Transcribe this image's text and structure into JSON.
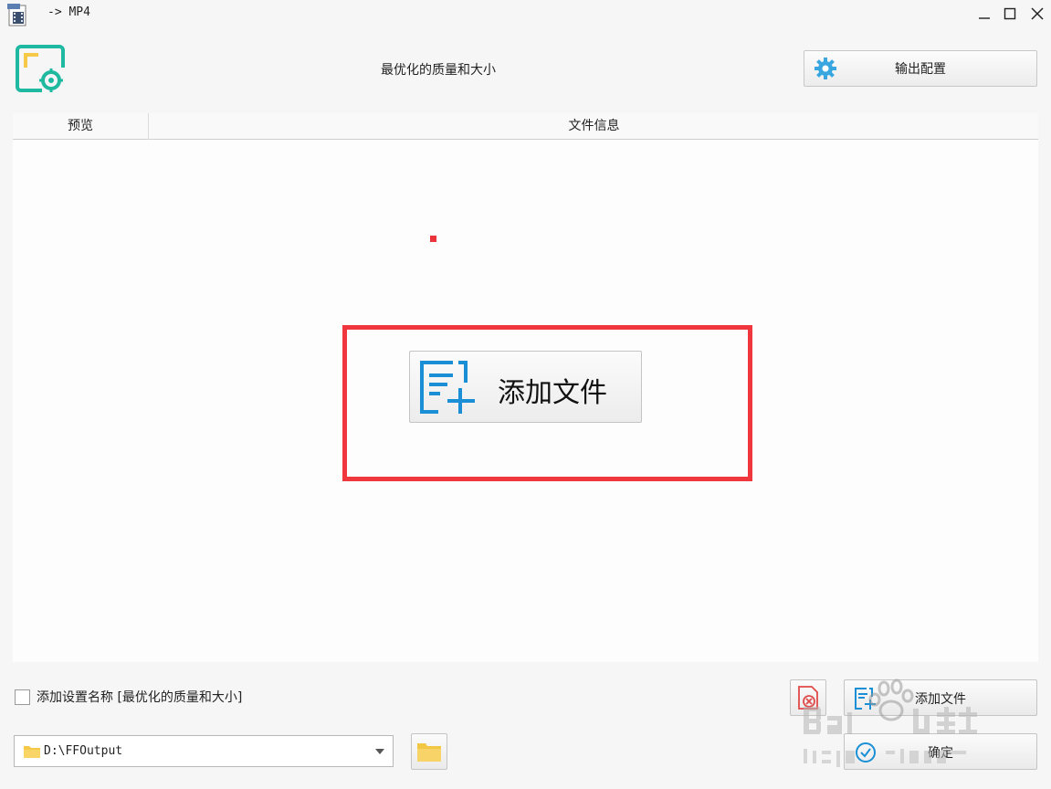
{
  "window": {
    "title": "-> MP4",
    "controls": {
      "minimize": "minimize-icon",
      "maximize": "maximize-icon",
      "close": "close-icon"
    }
  },
  "header": {
    "preset_title": "最优化的质量和大小",
    "output_config_label": "输出配置"
  },
  "file_list": {
    "columns": [
      "预览",
      "文件信息"
    ],
    "add_file_label": "添加文件"
  },
  "bottom": {
    "name_checkbox_label": "添加设置名称 [最优化的质量和大小]",
    "name_checkbox_checked": false,
    "output_path": "D:\\FFOutput",
    "add_file_label": "添加文件",
    "ok_label": "确定"
  },
  "watermark_text": "Bai du 经验 jingyan.baidu.com",
  "colors": {
    "accent_teal": "#1fb8a0",
    "accent_blue": "#1a8fd6",
    "gear_blue": "#3aa6e0",
    "highlight_red": "#f0373d",
    "folder_yellow": "#f7c948"
  }
}
